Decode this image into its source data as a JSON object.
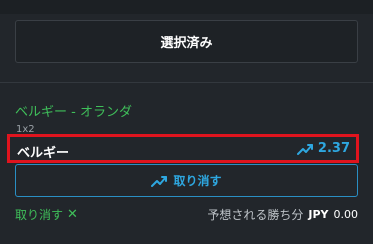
{
  "selected_button": {
    "label": "選択済み"
  },
  "match": {
    "title": "ベルギー - オランダ",
    "bet_type": "1x2"
  },
  "selection": {
    "name": "ベルギー",
    "odds": "2.37",
    "odds_icon": "trending-up-icon"
  },
  "cancel_button": {
    "label": "取り消す",
    "icon": "trending-up-icon"
  },
  "remove": {
    "label": "取り消す",
    "icon": "close-icon"
  },
  "winnings": {
    "label": "予想される勝ち分",
    "currency": "JPY",
    "amount": "0.00"
  },
  "colors": {
    "background": "#22262b",
    "accent_green": "#3fbf5a",
    "accent_blue": "#2ea7e0",
    "highlight_red": "#e0141e"
  }
}
